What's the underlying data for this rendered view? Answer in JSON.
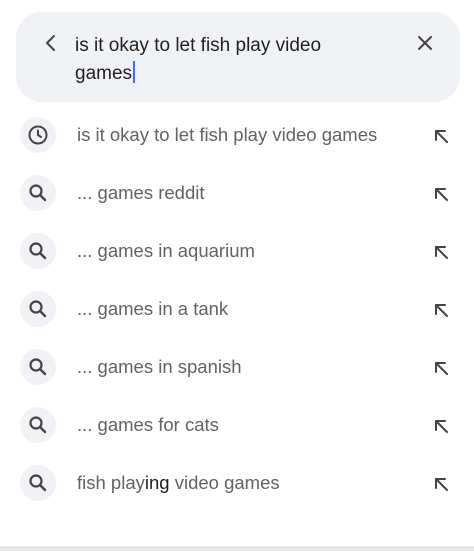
{
  "search": {
    "query": "is it okay to let fish play video games"
  },
  "icons": {
    "back": "chevron-left-icon",
    "clear": "close-icon",
    "history": "clock-icon",
    "search": "search-icon",
    "fill": "arrow-up-left-icon"
  },
  "colors": {
    "search_bg": "#f1f2f6",
    "icon_bg": "#f1f2f6",
    "text_muted": "#5f6368",
    "text_strong": "#1f1f1f",
    "caret": "#4a6cd4"
  },
  "suggestions": [
    {
      "icon": "clock-icon",
      "text": "is it okay to let fish play video games",
      "muted": "is it okay to let fish play video games",
      "strong": "",
      "tail": ""
    },
    {
      "icon": "search-icon",
      "text": "... games reddit",
      "muted": "... games reddit",
      "strong": "",
      "tail": ""
    },
    {
      "icon": "search-icon",
      "text": "... games in aquarium",
      "muted": "... games in aquarium",
      "strong": "",
      "tail": ""
    },
    {
      "icon": "search-icon",
      "text": "... games in a tank",
      "muted": "... games in a tank",
      "strong": "",
      "tail": ""
    },
    {
      "icon": "search-icon",
      "text": "... games in spanish",
      "muted": "... games in spanish",
      "strong": "",
      "tail": ""
    },
    {
      "icon": "search-icon",
      "text": "... games for cats",
      "muted": "... games for cats",
      "strong": "",
      "tail": ""
    },
    {
      "icon": "search-icon",
      "text": "fish playing video games",
      "muted": "fish play",
      "strong": "ing",
      "tail": " video games"
    }
  ]
}
